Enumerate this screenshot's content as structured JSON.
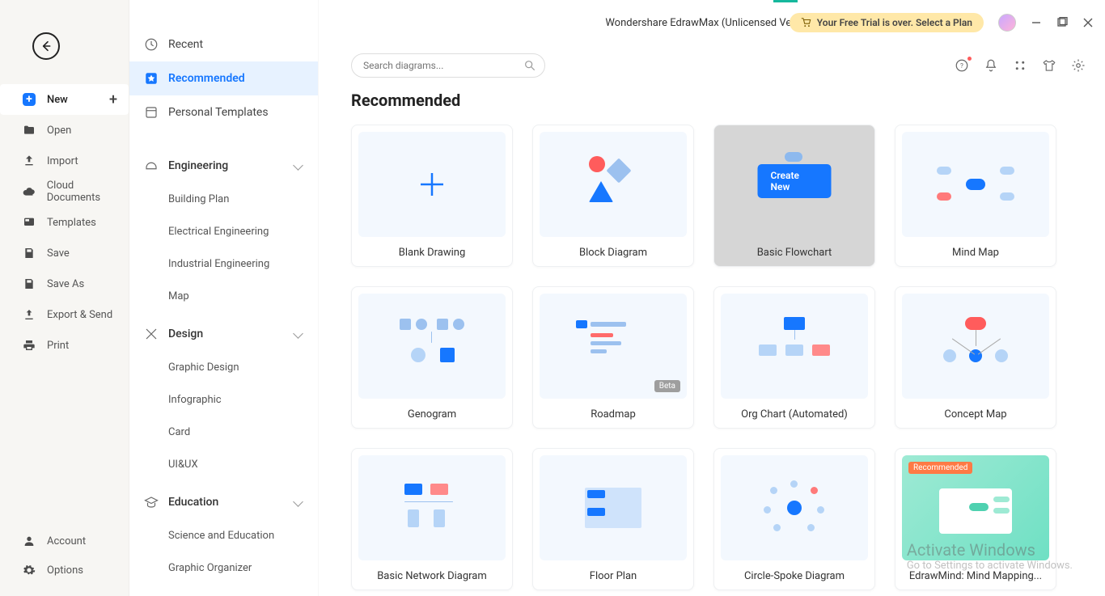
{
  "header": {
    "title": "Wondershare EdrawMax (Unlicensed Version)",
    "trial_text": "Your Free Trial is over. Select a Plan"
  },
  "search": {
    "placeholder": "Search diagrams..."
  },
  "left_sidebar": {
    "new": "New",
    "open": "Open",
    "import": "Import",
    "cloud": "Cloud Documents",
    "templates": "Templates",
    "save": "Save",
    "save_as": "Save As",
    "export": "Export & Send",
    "print": "Print",
    "account": "Account",
    "options": "Options"
  },
  "cat_sidebar": {
    "recent": "Recent",
    "recommended": "Recommended",
    "personal": "Personal Templates",
    "groups": [
      {
        "label": "Engineering",
        "items": [
          "Building Plan",
          "Electrical Engineering",
          "Industrial Engineering",
          "Map"
        ]
      },
      {
        "label": "Design",
        "items": [
          "Graphic Design",
          "Infographic",
          "Card",
          "UI&UX"
        ]
      },
      {
        "label": "Education",
        "items": [
          "Science and Education",
          "Graphic Organizer"
        ]
      }
    ]
  },
  "section_title": "Recommended",
  "cards": [
    {
      "label": "Blank Drawing"
    },
    {
      "label": "Block Diagram"
    },
    {
      "label": "Basic Flowchart",
      "hover": true,
      "create": "Create New"
    },
    {
      "label": "Mind Map"
    },
    {
      "label": "Genogram"
    },
    {
      "label": "Roadmap",
      "beta": "Beta"
    },
    {
      "label": "Org Chart (Automated)"
    },
    {
      "label": "Concept Map"
    },
    {
      "label": "Basic Network Diagram"
    },
    {
      "label": "Floor Plan"
    },
    {
      "label": "Circle-Spoke Diagram"
    },
    {
      "label": "EdrawMind: Mind Mapping...",
      "green": true,
      "rec": "Recommended"
    }
  ],
  "watermark": {
    "line1": "Activate Windows",
    "line2": "Go to Settings to activate Windows."
  }
}
